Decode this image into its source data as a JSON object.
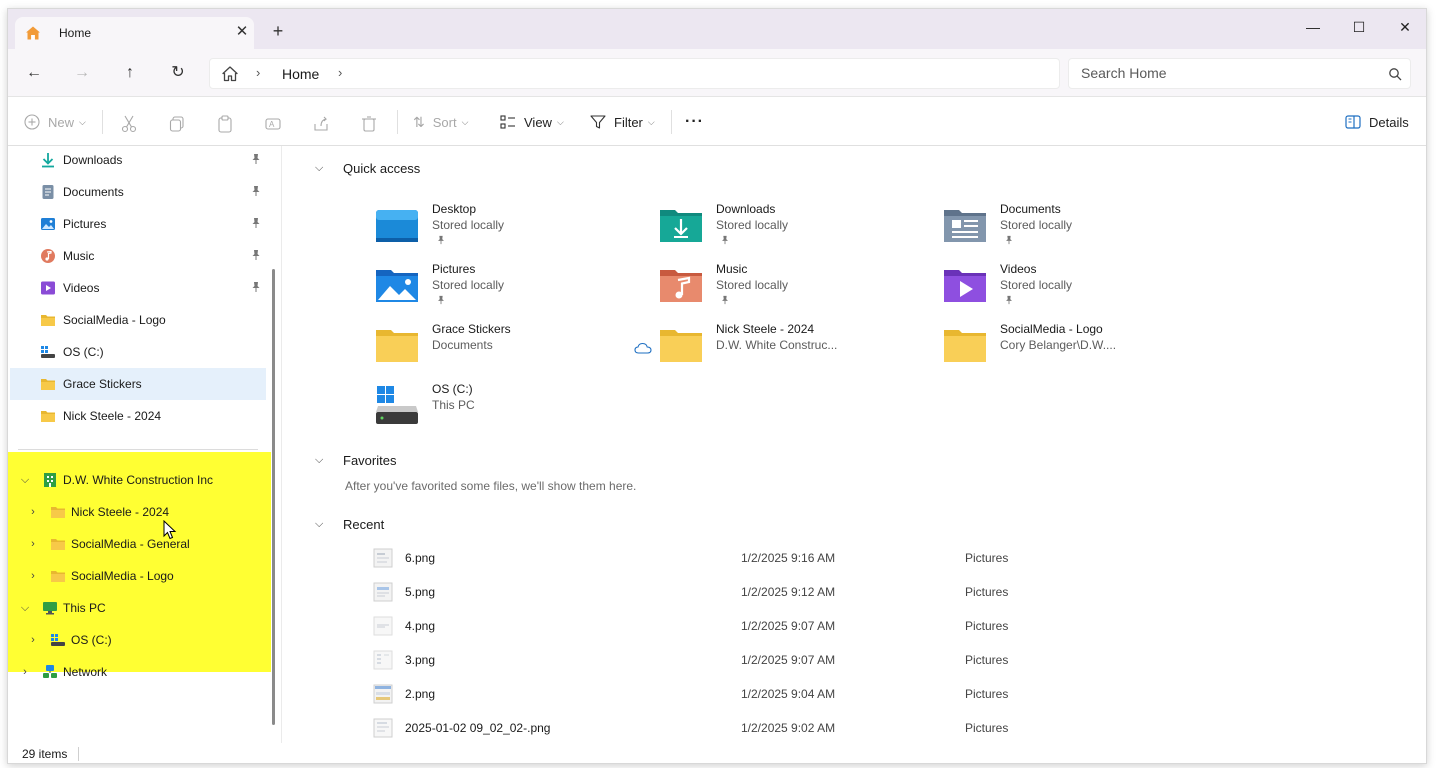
{
  "window": {
    "tab_title": "Home",
    "tab_close": "✕",
    "new_tab": "+",
    "minimize": "—",
    "maximize": "☐",
    "close": "✕"
  },
  "nav": {
    "back": "←",
    "forward": "→",
    "up": "↑",
    "refresh": "↻",
    "breadcrumb": [
      "Home"
    ],
    "separator": "›",
    "search_placeholder": "Search Home"
  },
  "toolbar": {
    "new_label": "New",
    "sort_label": "Sort",
    "view_label": "View",
    "filter_label": "Filter",
    "more_label": "···",
    "details_label": "Details"
  },
  "sidebar": {
    "pinned": [
      {
        "label": "Downloads",
        "icon": "downloads-icon",
        "pinned": true
      },
      {
        "label": "Documents",
        "icon": "documents-icon",
        "pinned": true
      },
      {
        "label": "Pictures",
        "icon": "pictures-icon",
        "pinned": true
      },
      {
        "label": "Music",
        "icon": "music-icon",
        "pinned": true
      },
      {
        "label": "Videos",
        "icon": "videos-icon",
        "pinned": true
      },
      {
        "label": "SocialMedia - Logo",
        "icon": "folder-icon",
        "pinned": false
      },
      {
        "label": "OS (C:)",
        "icon": "drive-icon",
        "pinned": false
      },
      {
        "label": "Grace Stickers",
        "icon": "folder-icon",
        "pinned": false,
        "selected": true
      },
      {
        "label": "Nick Steele - 2024",
        "icon": "folder-icon",
        "pinned": false
      }
    ],
    "tree": [
      {
        "label": "D.W. White Construction Inc",
        "expanded": true,
        "level": 0
      },
      {
        "label": "Nick Steele - 2024",
        "expanded": false,
        "level": 1
      },
      {
        "label": "SocialMedia - General",
        "expanded": false,
        "level": 1
      },
      {
        "label": "SocialMedia - Logo",
        "expanded": false,
        "level": 1
      },
      {
        "label": "This PC",
        "expanded": true,
        "level": 0
      },
      {
        "label": "OS (C:)",
        "expanded": false,
        "level": 1
      },
      {
        "label": "Network",
        "expanded": false,
        "level": 0
      }
    ],
    "highlight_color": "#ffff33"
  },
  "status": {
    "items_count": "29 items"
  },
  "main": {
    "quick_access_title": "Quick access",
    "quick_access": [
      {
        "name": "Desktop",
        "sub": "Stored locally",
        "pinned": true
      },
      {
        "name": "Downloads",
        "sub": "Stored locally",
        "pinned": true
      },
      {
        "name": "Documents",
        "sub": "Stored locally",
        "pinned": true
      },
      {
        "name": "Pictures",
        "sub": "Stored locally",
        "pinned": true
      },
      {
        "name": "Music",
        "sub": "Stored locally",
        "pinned": true
      },
      {
        "name": "Videos",
        "sub": "Stored locally",
        "pinned": true
      },
      {
        "name": "Grace Stickers",
        "sub": "Documents",
        "pinned": false
      },
      {
        "name": "Nick Steele - 2024",
        "sub": "D.W. White Construc...",
        "pinned": false,
        "cloud": true
      },
      {
        "name": "SocialMedia - Logo",
        "sub": "Cory Belanger\\D.W....",
        "pinned": false
      },
      {
        "name": "OS (C:)",
        "sub": "This PC",
        "pinned": false
      }
    ],
    "favorites_title": "Favorites",
    "favorites_empty": "After you've favorited some files, we'll show them here.",
    "recent_title": "Recent",
    "recent": [
      {
        "name": "6.png",
        "date": "1/2/2025 9:16 AM",
        "location": "Pictures"
      },
      {
        "name": "5.png",
        "date": "1/2/2025 9:12 AM",
        "location": "Pictures"
      },
      {
        "name": "4.png",
        "date": "1/2/2025 9:07 AM",
        "location": "Pictures"
      },
      {
        "name": "3.png",
        "date": "1/2/2025 9:07 AM",
        "location": "Pictures"
      },
      {
        "name": "2.png",
        "date": "1/2/2025 9:04 AM",
        "location": "Pictures"
      },
      {
        "name": "2025-01-02 09_02_02-.png",
        "date": "1/2/2025 9:02 AM",
        "location": "Pictures"
      }
    ]
  },
  "colors": {
    "titlebar": "#ece7f1",
    "selected": "#e5f0fb",
    "folder": "#f7c948"
  }
}
